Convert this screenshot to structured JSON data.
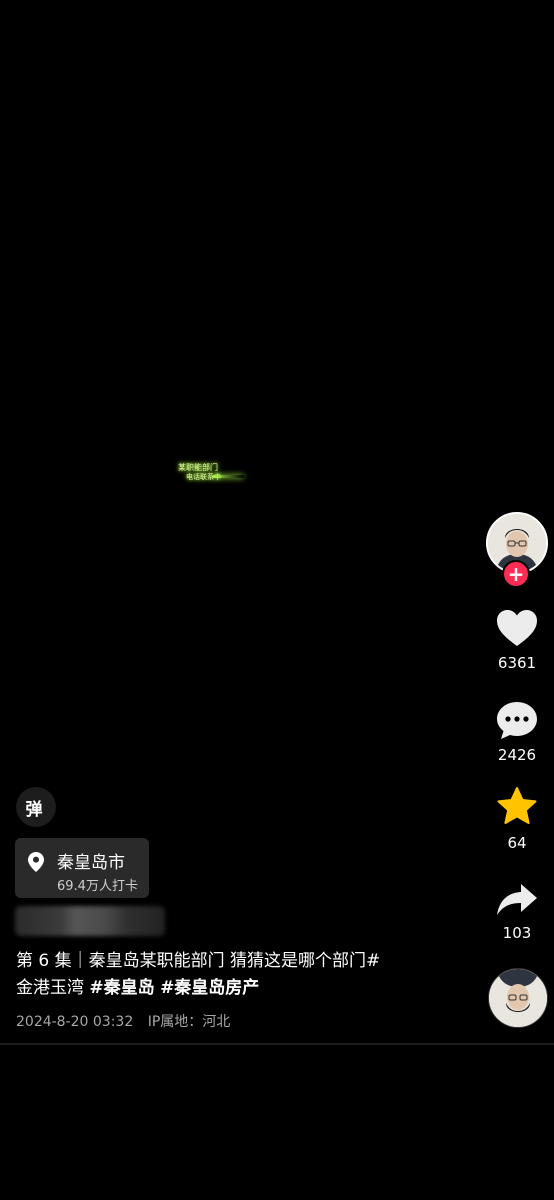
{
  "video": {
    "subtitle_line1": "某职能部门",
    "subtitle_line2": "电话联系中"
  },
  "rail": {
    "likes": "6361",
    "comments": "2426",
    "favorites": "64",
    "shares": "103",
    "follow_symbol": "+"
  },
  "danmu": {
    "label": "弹"
  },
  "location": {
    "name": "秦皇岛市",
    "checkins": "69.4万人打卡"
  },
  "caption": {
    "text_part1": "第 6 集｜秦皇岛某职能部门 猜猜这是哪个部门#",
    "text_part2": "金港玉湾",
    "hashtag1": "#秦皇岛",
    "hashtag2": "#秦皇岛房产"
  },
  "meta": {
    "date": "2024-8-20 03:32",
    "ip": "IP属地：河北"
  },
  "colors": {
    "accent_red": "#fe2c55",
    "background": "#000000",
    "favorite_yellow": "#ffc300"
  }
}
